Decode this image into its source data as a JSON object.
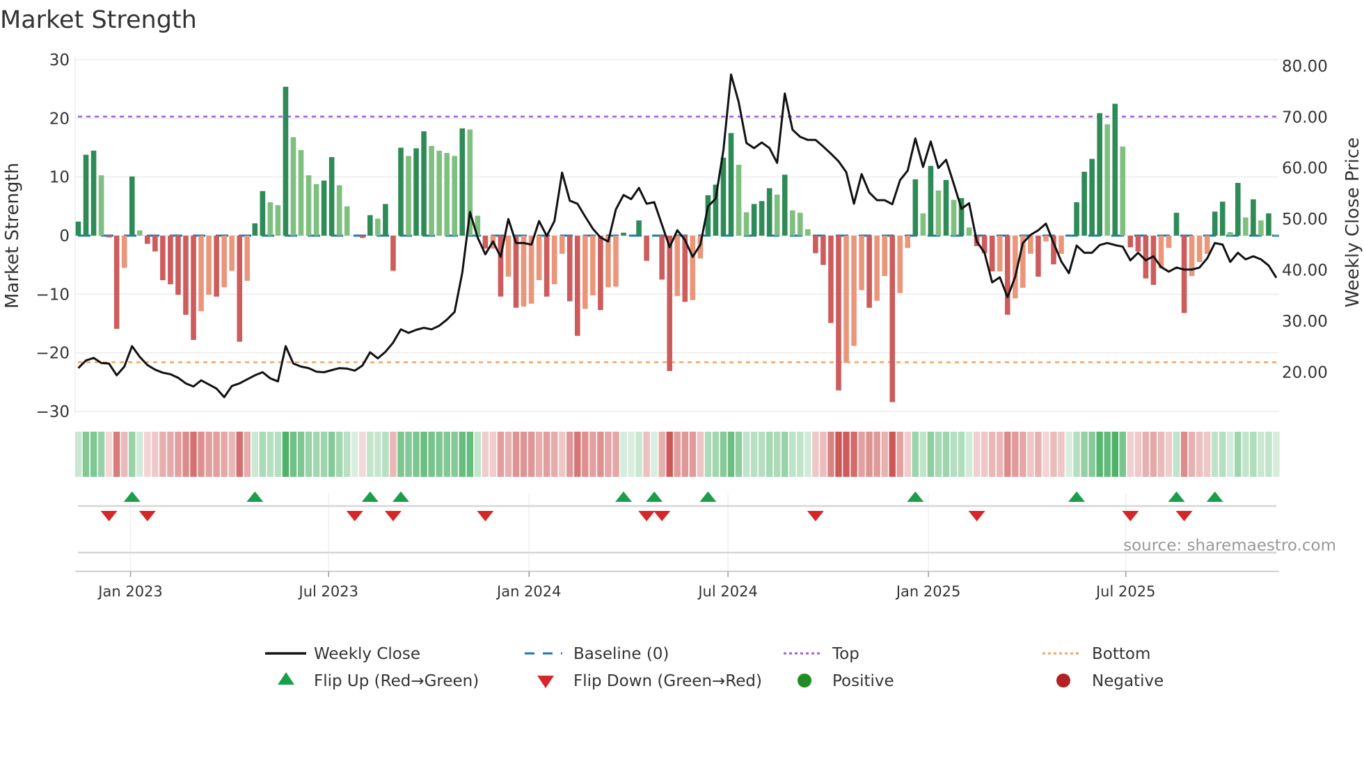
{
  "chart_data": {
    "type": "bar",
    "title": "Market Strength",
    "ylabel": "Market Strength",
    "y2label": "Weekly Close Price",
    "ylim": [
      -30,
      30
    ],
    "y2lim": [
      12.3,
      81.2
    ],
    "yticks": [
      30,
      20,
      10,
      0,
      -10,
      -20,
      -30
    ],
    "yticklabels": [
      "30",
      "20",
      "10",
      "0",
      "−10",
      "−20",
      "−30"
    ],
    "y2ticks": [
      80,
      70,
      60,
      50,
      40,
      30,
      20
    ],
    "y2ticklabels": [
      "80.00",
      "70.00",
      "60.00",
      "50.00",
      "40.00",
      "30.00",
      "20.00"
    ],
    "xticks": [
      {
        "week": 6.8,
        "label": "Jan 2023"
      },
      {
        "week": 32.6,
        "label": "Jul 2023"
      },
      {
        "week": 58.7,
        "label": "Jan 2024"
      },
      {
        "week": 84.6,
        "label": "Jul 2024"
      },
      {
        "week": 110.7,
        "label": "Jan 2025"
      },
      {
        "week": 136.4,
        "label": "Jul 2025"
      }
    ],
    "grid": true,
    "top_level": 20.3,
    "bottom_level": -21.6,
    "baseline": 0,
    "strength": [
      2.4,
      13.8,
      14.5,
      10.3,
      -0.3,
      -15.9,
      -5.5,
      10.1,
      0.9,
      -1.4,
      -2.7,
      -7.6,
      -8.3,
      -10.1,
      -13.5,
      -17.8,
      -12.9,
      -10.1,
      -10.4,
      -8.8,
      -6.0,
      -18.1,
      -7.7,
      2.1,
      7.6,
      5.7,
      5.2,
      25.4,
      16.8,
      14.6,
      10.3,
      8.8,
      9.4,
      13.4,
      8.6,
      5.0,
      0,
      -0.4,
      3.5,
      2.9,
      5.4,
      -6.0,
      15.0,
      13.6,
      14.9,
      17.8,
      15.3,
      14.5,
      14.1,
      13.6,
      18.3,
      18.1,
      3.4,
      -2.2,
      -2.2,
      -10.4,
      -7.0,
      -12.3,
      -12.1,
      -11.6,
      -7.6,
      -10.4,
      -8.3,
      -3.1,
      -11.2,
      -17.1,
      -12.5,
      -10.2,
      -12.7,
      -8.8,
      -8.7,
      0.5,
      0,
      2.6,
      -4.3,
      0,
      -7.5,
      -23.1,
      -10.3,
      -11.3,
      -11.0,
      -3.9,
      6.9,
      8.7,
      13.3,
      17.5,
      12.1,
      4.0,
      5.4,
      5.9,
      8.1,
      7.0,
      10.4,
      4.3,
      3.9,
      1.1,
      -3.0,
      -5.0,
      -14.9,
      -26.4,
      -21.7,
      -18.8,
      -9.3,
      -12.3,
      -11.1,
      -6.9,
      -28.4,
      -9.8,
      -2.1,
      9.6,
      3.8,
      11.9,
      7.7,
      9.5,
      6.1,
      6.4,
      1.4,
      -1.8,
      -3.0,
      -6.1,
      -6.1,
      -13.5,
      -10.7,
      -8.9,
      -3.1,
      -7.0,
      -1.0,
      -4.9,
      -3.1,
      0,
      5.7,
      10.9,
      13.1,
      20.9,
      19.0,
      22.5,
      15.2,
      -2.0,
      -2.7,
      -7.3,
      -8.4,
      -5.6,
      -2.1,
      3.9,
      -13.2,
      -6.9,
      -4.5,
      -3.1,
      4.1,
      5.8,
      0.6,
      9.0,
      3.1,
      6.2,
      2.6,
      3.8,
      0.2
    ],
    "weekly_close": [
      20.8,
      22.3,
      22.8,
      21.8,
      21.7,
      19.4,
      21.1,
      25.1,
      23.0,
      21.4,
      20.5,
      19.9,
      19.6,
      18.9,
      17.8,
      17.2,
      18.4,
      17.6,
      16.8,
      15.1,
      17.3,
      17.8,
      18.6,
      19.4,
      20.0,
      18.8,
      18.2,
      25.1,
      21.7,
      21.1,
      20.8,
      20.1,
      20.0,
      20.4,
      20.8,
      20.7,
      20.3,
      21.3,
      23.9,
      22.7,
      24.0,
      25.8,
      28.4,
      27.7,
      28.3,
      28.7,
      28.4,
      29.1,
      30.3,
      31.8,
      39.5,
      51.4,
      46.4,
      43.1,
      45.6,
      42.6,
      50.0,
      45.3,
      45.3,
      45.0,
      49.6,
      46.7,
      49.6,
      59.1,
      53.6,
      53.0,
      50.5,
      48.1,
      46.4,
      45.6,
      51.9,
      54.7,
      53.9,
      56.1,
      53.0,
      53.3,
      48.9,
      44.5,
      47.8,
      45.9,
      42.6,
      45.0,
      52.5,
      54.0,
      63.5,
      78.3,
      72.9,
      64.9,
      63.9,
      65.0,
      63.9,
      61.0,
      74.6,
      67.5,
      66.1,
      65.5,
      65.5,
      64.2,
      62.8,
      61.3,
      59.2,
      53.0,
      58.8,
      55.2,
      53.7,
      53.7,
      52.9,
      57.6,
      59.5,
      65.8,
      60.2,
      65.2,
      60.0,
      61.6,
      56.9,
      52.0,
      53.1,
      45.6,
      43.4,
      37.6,
      38.6,
      34.7,
      38.7,
      45.3,
      46.9,
      47.8,
      49.1,
      45.3,
      41.7,
      39.4,
      44.8,
      43.4,
      43.4,
      44.9,
      45.3,
      44.9,
      44.6,
      41.9,
      43.4,
      41.9,
      42.7,
      40.6,
      39.7,
      40.5,
      40.1,
      40.1,
      40.5,
      42.3,
      45.3,
      45.0,
      41.6,
      43.4,
      42.1,
      42.7,
      42.1,
      40.9,
      38.5
    ],
    "flip_up_weeks": [
      7,
      23,
      38,
      42,
      71,
      75,
      82,
      109,
      130,
      143,
      148
    ],
    "flip_down_weeks": [
      4,
      9,
      36,
      41,
      53,
      74,
      76,
      96,
      117,
      137,
      144
    ],
    "legend": {
      "placement": "bottom",
      "items": [
        {
          "label": "Weekly Close",
          "key": "line"
        },
        {
          "label": "Baseline (0)",
          "key": "dash"
        },
        {
          "label": "Top",
          "key": "top"
        },
        {
          "label": "Bottom",
          "key": "bottom"
        },
        {
          "label": "Flip Up (Red→Green)",
          "key": "up"
        },
        {
          "label": "Flip Down (Green→Red)",
          "key": "down"
        },
        {
          "label": "Positive",
          "key": "pos"
        },
        {
          "label": "Negative",
          "key": "neg"
        }
      ]
    },
    "annotation": "source: sharemaestro.com"
  },
  "colors": {
    "pos_strong": "#2e8b57",
    "pos_weak": "#7fbf7f",
    "neg_strong": "#cd5c5c",
    "neg_weak": "#e9967a",
    "line": "#111111",
    "baseline": "#1f77b4",
    "top": "#9b5de5",
    "bottom": "#f4a261",
    "flip_up": "#1a9e4a",
    "flip_down": "#d62728",
    "positive_dot": "#228b22",
    "negative_dot": "#b22222"
  }
}
